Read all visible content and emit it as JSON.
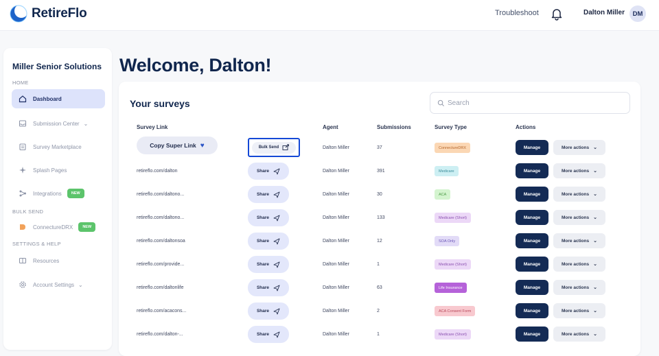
{
  "brand": {
    "name": "RetireFlo"
  },
  "header": {
    "troubleshoot": "Troubleshoot",
    "user_name": "Dalton Miller",
    "user_initials": "DM"
  },
  "sidebar": {
    "org_name": "Miller Senior Solutions",
    "sections": {
      "home": "HOME",
      "bulk_send": "BULK SEND",
      "settings": "SETTINGS & HELP"
    },
    "items": [
      {
        "label": "Dashboard",
        "icon": "home-icon",
        "active": true
      },
      {
        "label": "Submission Center",
        "icon": "inbox-icon",
        "chevron": true
      },
      {
        "label": "Survey Marketplace",
        "icon": "store-icon"
      },
      {
        "label": "Splash Pages",
        "icon": "sparkle-icon"
      },
      {
        "label": "Integrations",
        "icon": "integration-icon",
        "badge": "NEW"
      },
      {
        "label": "ConnectureDRX",
        "icon": "drx-icon",
        "badge": "NEW"
      },
      {
        "label": "Resources",
        "icon": "book-icon"
      },
      {
        "label": "Account Settings",
        "icon": "gear-icon",
        "chevron": true
      }
    ]
  },
  "main": {
    "welcome": "Welcome, Dalton!",
    "card_title": "Your surveys",
    "search_placeholder": "Search",
    "columns": [
      "Survey Link",
      "Agent",
      "Submissions",
      "Survey Type",
      "Actions"
    ],
    "copy_super_link": "Copy Super Link",
    "bulk_send": "Bulk Send",
    "share": "Share",
    "manage": "Manage",
    "more_actions": "More actions",
    "rows": [
      {
        "link": "",
        "agent": "Dalton Miller",
        "submissions": "37",
        "type": "ConnectureDRX",
        "type_bg": "#fbd7b4",
        "type_fg": "#b5652a"
      },
      {
        "link": "retireflo.com/dalton",
        "agent": "Dalton Miller",
        "submissions": "391",
        "type": "Medicare",
        "type_bg": "#cdeff3",
        "type_fg": "#3a8c99"
      },
      {
        "link": "retireflo.com/daltono...",
        "agent": "Dalton Miller",
        "submissions": "30",
        "type": "ACA",
        "type_bg": "#d4f4cf",
        "type_fg": "#4b9a45"
      },
      {
        "link": "retireflo.com/daltono...",
        "agent": "Dalton Miller",
        "submissions": "133",
        "type": "Medicare (Short)",
        "type_bg": "#ecd8f7",
        "type_fg": "#8a4fb0"
      },
      {
        "link": "retireflo.com/daltonsoa",
        "agent": "Dalton Miller",
        "submissions": "12",
        "type": "SOA Only",
        "type_bg": "#e2dbf7",
        "type_fg": "#6a55b8"
      },
      {
        "link": "retireflo.com/provide...",
        "agent": "Dalton Miller",
        "submissions": "1",
        "type": "Medicare (Short)",
        "type_bg": "#ecd8f7",
        "type_fg": "#8a4fb0"
      },
      {
        "link": "retireflo.com/daltonlife",
        "agent": "Dalton Miller",
        "submissions": "63",
        "type": "Life Insurance",
        "type_bg": "#b562d9",
        "type_fg": "#ffffff"
      },
      {
        "link": "retireflo.com/acacons...",
        "agent": "Dalton Miller",
        "submissions": "2",
        "type": "ACA Consent Form",
        "type_bg": "#f8c9cf",
        "type_fg": "#b8485a"
      },
      {
        "link": "retireflo.com/dalton-...",
        "agent": "Dalton Miller",
        "submissions": "1",
        "type": "Medicare (Short)",
        "type_bg": "#ecd8f7",
        "type_fg": "#8a4fb0"
      }
    ]
  }
}
